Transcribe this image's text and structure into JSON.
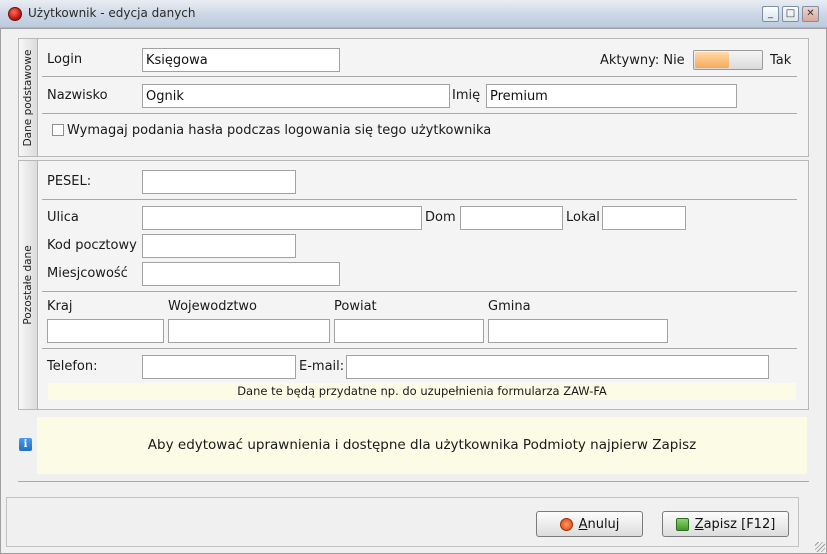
{
  "window": {
    "title": "Użytkownik - edycja danych",
    "minimize": "_",
    "maximize": "□",
    "close": "✕"
  },
  "basic": {
    "tab_label": "Dane podstawowe",
    "login_label": "Login",
    "login_value": "Księgowa",
    "active_label": "Aktywny: Nie",
    "active_on": "Tak",
    "active_value": "Nie",
    "surname_label": "Nazwisko",
    "surname_value": "Ognik",
    "firstname_label": "Imię",
    "firstname_value": "Premium",
    "require_password_label": "Wymagaj podania hasła podczas logowania się tego użytkownika"
  },
  "other": {
    "tab_label": "Pozostałe dane",
    "pesel_label": "PESEL:",
    "pesel_value": "",
    "street_label": "Ulica",
    "street_value": "",
    "house_label": "Dom",
    "house_value": "",
    "flat_label": "Lokal",
    "flat_value": "",
    "postcode_label": "Kod pocztowy",
    "postcode_value": "",
    "city_label": "Miesjcowość",
    "city_value": "",
    "country_label": "Kraj",
    "country_value": "",
    "voivodeship_label": "Wojewodztwo",
    "voivodeship_value": "",
    "district_label": "Powiat",
    "district_value": "",
    "commune_label": "Gmina",
    "commune_value": "",
    "phone_label": "Telefon:",
    "phone_value": "",
    "email_label": "E-mail:",
    "email_value": "",
    "note": "Dane te będą przydatne np. do uzupełnienia formularza ZAW-FA"
  },
  "info": {
    "icon": "info-icon",
    "text": "Aby edytować uprawnienia i dostępne dla użytkownika Podmioty najpierw Zapisz"
  },
  "footer": {
    "cancel_underlined": "A",
    "cancel_rest": "nuluj",
    "save_underlined": "Z",
    "save_rest": "apisz [F12]"
  },
  "colors": {
    "toggle_accent": "#f5a95a",
    "note_background": "#fbfbe6"
  }
}
